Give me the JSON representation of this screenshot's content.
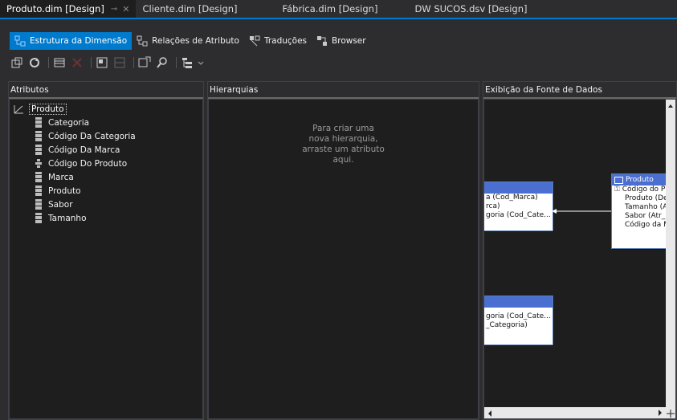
{
  "document_tabs": [
    {
      "label": "Produto.dim [Design]",
      "active": true
    },
    {
      "label": "Cliente.dim [Design]",
      "active": false
    },
    {
      "label": "Fábrica.dim [Design]",
      "active": false
    },
    {
      "label": "DW SUCOS.dsv [Design]",
      "active": false
    }
  ],
  "view_tabs": [
    {
      "label": "Estrutura da Dimensão",
      "active": true
    },
    {
      "label": "Relações de Atributo",
      "active": false
    },
    {
      "label": "Traduções",
      "active": false
    },
    {
      "label": "Browser",
      "active": false
    }
  ],
  "panels": {
    "atributos": {
      "title": "Atributos",
      "root": "Produto",
      "items": [
        "Categoria",
        "Código Da Categoria",
        "Código Da Marca",
        "Código Do Produto",
        "Marca",
        "Produto",
        "Sabor",
        "Tamanho"
      ],
      "key_item_index": 3
    },
    "hierarquias": {
      "title": "Hierarquias",
      "empty_message_lines": [
        "Para criar uma",
        "nova hierarquia,",
        "arraste um atributo",
        "aqui."
      ]
    },
    "dsv": {
      "title": "Exibição da Fonte de Dados",
      "table_left": {
        "rows": [
          "a (Cod_Marca)",
          "rca)",
          "goria (Cod_Cate..."
        ]
      },
      "table_produto": {
        "name": "Produto",
        "rows": [
          "Código do P",
          "Produto (De",
          "Tamanho (A",
          "Sabor (Atr_",
          "Código da M"
        ]
      },
      "table_bottom": {
        "rows": [
          "goria (Cod_Cate...",
          "_Categoria)"
        ]
      }
    }
  },
  "colors": {
    "accent": "#007acc",
    "table_header": "#4a6fd0",
    "background": "#2d2d30"
  }
}
